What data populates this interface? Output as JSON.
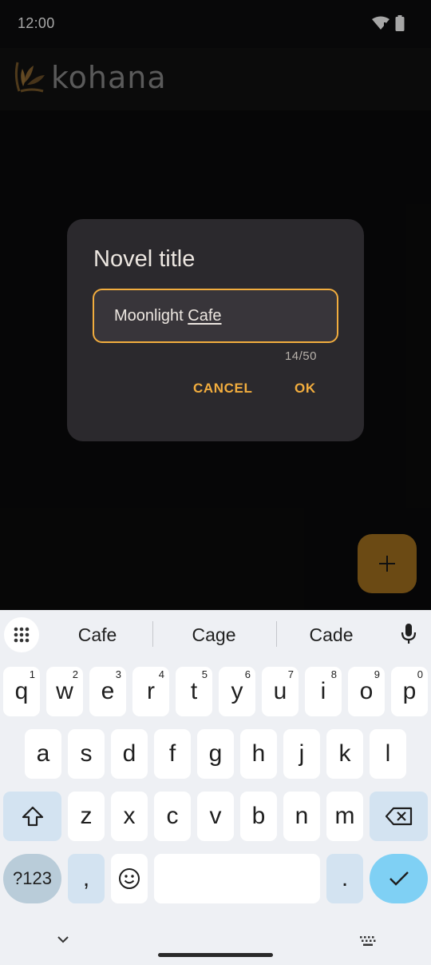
{
  "status": {
    "time": "12:00"
  },
  "app": {
    "logo_text": "kohana"
  },
  "dialog": {
    "title": "Novel title",
    "value_part1": "Moonlight ",
    "value_part2": "Cafe",
    "counter": "14/50",
    "cancel": "CANCEL",
    "ok": "OK"
  },
  "fab": {
    "icon": "plus-icon"
  },
  "keyboard": {
    "suggestions": [
      "Cafe",
      "Cage",
      "Cade"
    ],
    "row1": [
      {
        "k": "q",
        "h": "1"
      },
      {
        "k": "w",
        "h": "2"
      },
      {
        "k": "e",
        "h": "3"
      },
      {
        "k": "r",
        "h": "4"
      },
      {
        "k": "t",
        "h": "5"
      },
      {
        "k": "y",
        "h": "6"
      },
      {
        "k": "u",
        "h": "7"
      },
      {
        "k": "i",
        "h": "8"
      },
      {
        "k": "o",
        "h": "9"
      },
      {
        "k": "p",
        "h": "0"
      }
    ],
    "row2": [
      "a",
      "s",
      "d",
      "f",
      "g",
      "h",
      "j",
      "k",
      "l"
    ],
    "row3": [
      "z",
      "x",
      "c",
      "v",
      "b",
      "n",
      "m"
    ],
    "sym_label": "?123",
    "comma": ",",
    "period": "."
  },
  "colors": {
    "accent": "#f2ad3e",
    "dialog_bg": "#2b292d",
    "fab_bg": "#6b4a14",
    "enter_key": "#7fd0f4"
  }
}
